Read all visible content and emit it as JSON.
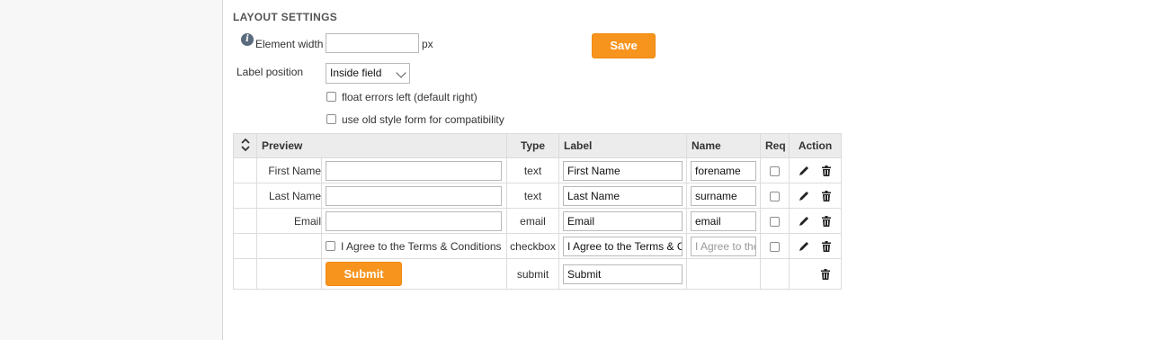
{
  "section": {
    "title": "LAYOUT SETTINGS"
  },
  "layout": {
    "element_width_label": "Element width",
    "element_width_value": "",
    "unit": "px",
    "label_position_label": "Label position",
    "label_position_value": "Inside field",
    "float_errors_label": "float errors left (default right)",
    "float_errors_checked": false,
    "old_style_label": "use old style form for compatibility",
    "old_style_checked": false,
    "save_label": "Save"
  },
  "table": {
    "headers": {
      "preview": "Preview",
      "type": "Type",
      "label": "Label",
      "name": "Name",
      "req": "Req",
      "action": "Action"
    },
    "rows": [
      {
        "preview_label": "First Name",
        "type": "text",
        "label": "First Name",
        "name": "forename"
      },
      {
        "preview_label": "Last Name",
        "type": "text",
        "label": "Last Name",
        "name": "surname"
      },
      {
        "preview_label": "Email",
        "type": "email",
        "label": "Email",
        "name": "email"
      },
      {
        "preview_label": "",
        "checkbox_text": "I Agree to the Terms & Conditions",
        "type": "checkbox",
        "label": "I Agree to the Terms & Conditions",
        "name_placeholder": "I Agree to the Terms & Conditions"
      },
      {
        "preview_button": "Submit",
        "type": "submit",
        "label": "Submit"
      }
    ]
  },
  "colors": {
    "accent": "#f7941d",
    "header_bg": "#ececec",
    "gutter_bg": "#f7f7f7"
  },
  "icons": {
    "info": "info-icon",
    "sort": "sort-icon",
    "edit": "pencil-icon",
    "delete": "trash-icon"
  }
}
